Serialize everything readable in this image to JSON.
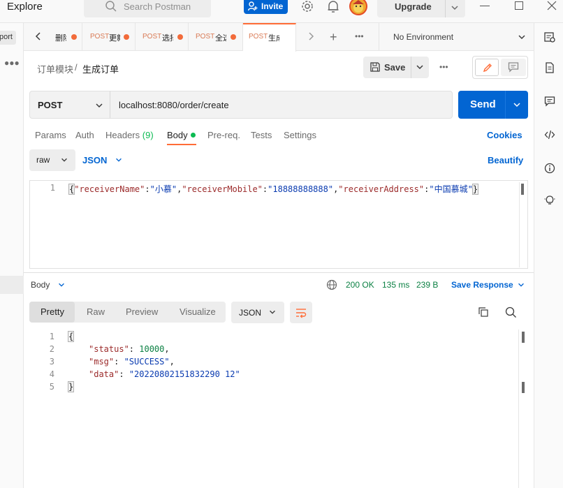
{
  "topbar": {
    "explore": "Explore",
    "search_placeholder": "Search Postman",
    "invite": "Invite",
    "upgrade": "Upgrade"
  },
  "sidebar": {
    "import_label": "port"
  },
  "tabs": [
    {
      "method": "",
      "name": "删除"
    },
    {
      "method": "POST",
      "name": "更新"
    },
    {
      "method": "POST",
      "name": "选择"
    },
    {
      "method": "POST",
      "name": "全选"
    },
    {
      "method": "POST",
      "name": "生成"
    }
  ],
  "environment": "No Environment",
  "breadcrumb": {
    "parent": "订单模块",
    "separator": "/",
    "current": "生成订单"
  },
  "save_label": "Save",
  "request": {
    "method": "POST",
    "url": "localhost:8080/order/create",
    "send_label": "Send"
  },
  "request_tabs": {
    "params": "Params",
    "auth": "Auth",
    "headers": "Headers",
    "headers_count": "(9)",
    "body": "Body",
    "prereq": "Pre-req.",
    "tests": "Tests",
    "settings": "Settings",
    "cookies": "Cookies"
  },
  "body_mode": {
    "mode": "raw",
    "language": "JSON",
    "beautify": "Beautify"
  },
  "request_body": {
    "line": "1",
    "open": "{",
    "k1": "\"receiverName\"",
    "v1": "\"小慕\"",
    "k2": "\"receiverMobile\"",
    "v2": "\"18888888888\"",
    "k3": "\"receiverAddress\"",
    "v3": "\"中国慕城\"",
    "close": "}"
  },
  "response": {
    "body_label": "Body",
    "status": "200 OK",
    "time": "135 ms",
    "size": "239 B",
    "save_response": "Save Response",
    "view_tabs": [
      "Pretty",
      "Raw",
      "Preview",
      "Visualize"
    ],
    "format": "JSON",
    "lines": [
      "1",
      "2",
      "3",
      "4",
      "5"
    ],
    "open": "{",
    "status_key": "\"status\"",
    "status_value": "10000",
    "msg_key": "\"msg\"",
    "msg_value": "\"SUCCESS\"",
    "data_key": "\"data\"",
    "data_value": "\"20220802151832290 12\"",
    "close": "}"
  },
  "colors": {
    "accent": "#ff6c37",
    "primary": "#0265d2",
    "success": "#0cbb52"
  }
}
